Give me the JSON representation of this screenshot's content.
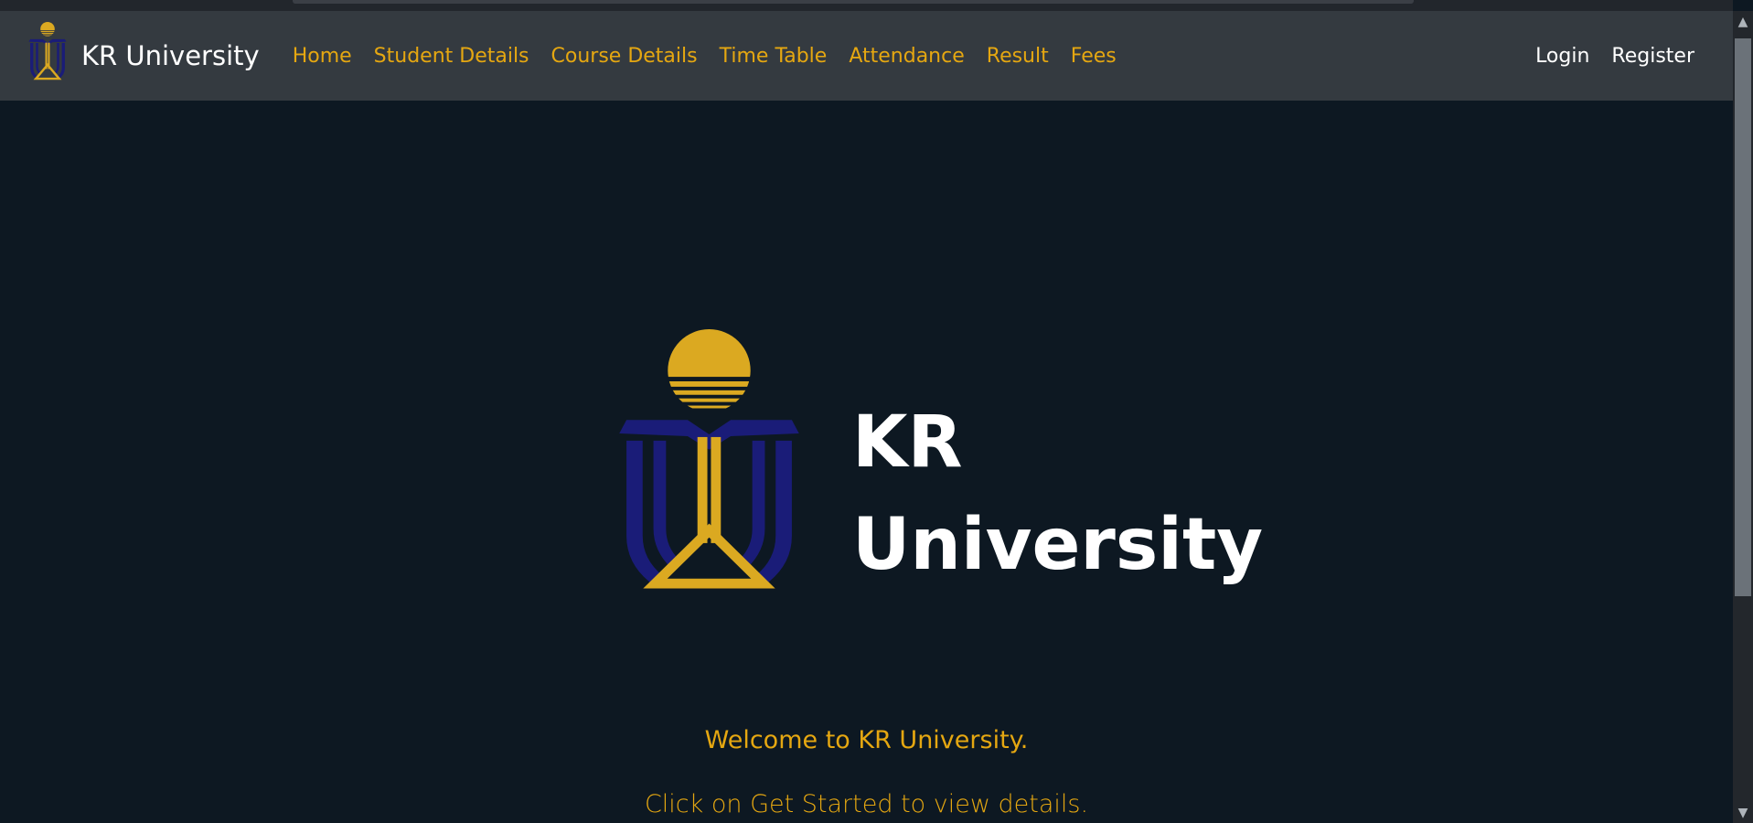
{
  "brand": {
    "name": "KR University",
    "logo": "kr-university-logo"
  },
  "nav": {
    "links": [
      "Home",
      "Student Details",
      "Course Details",
      "Time Table",
      "Attendance",
      "Result",
      "Fees"
    ],
    "right": [
      "Login",
      "Register"
    ]
  },
  "hero": {
    "title_line1": "KR",
    "title_line2": "University",
    "welcome": "Welcome to KR University.",
    "subtitle": "Click on Get Started to view details."
  },
  "colors": {
    "background": "#0d1822",
    "navbar": "#343a40",
    "accent_gold": "#e5a711",
    "logo_gold": "#dba921",
    "logo_blue": "#1a1c78"
  },
  "icons": {
    "scroll_up": "▲",
    "scroll_down": "▼"
  }
}
